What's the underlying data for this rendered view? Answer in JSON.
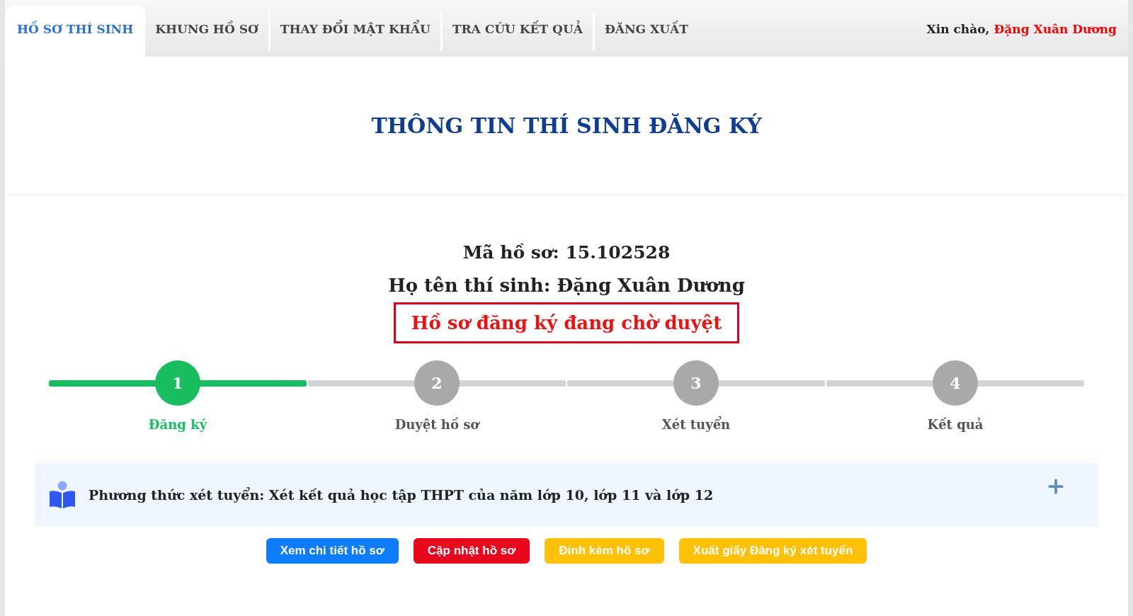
{
  "nav": {
    "tabs": [
      {
        "label": "HỒ SƠ THÍ SINH",
        "selected": true
      },
      {
        "label": "KHUNG HỒ SƠ",
        "selected": false
      },
      {
        "label": "THAY ĐỔI MẬT KHẨU",
        "selected": false
      },
      {
        "label": "TRA CỨU KẾT QUẢ",
        "selected": false
      },
      {
        "label": "ĐĂNG XUẤT",
        "selected": false
      }
    ],
    "greeting": {
      "label": "Xin chào,",
      "name": "Đặng Xuân Dương"
    }
  },
  "page_title": "THÔNG TIN THÍ SINH ĐĂNG KÝ",
  "profile": {
    "code": "Mã hồ sơ: 15.102528",
    "name": "Họ tên thí sinh: Đặng Xuân Dương",
    "status": "Hồ sơ đăng ký đang chờ duyệt"
  },
  "steps": [
    {
      "number": "1",
      "label": "Đăng ký",
      "active": true
    },
    {
      "number": "2",
      "label": "Duyệt hồ sơ",
      "active": false
    },
    {
      "number": "3",
      "label": "Xét tuyển",
      "active": false
    },
    {
      "number": "4",
      "label": "Kết quả",
      "active": false
    }
  ],
  "admission_method": {
    "text": "Phương thức xét tuyển: Xét kết quả học tập THPT của năm lớp 10, lớp 11 và lớp 12",
    "expanded": false
  },
  "buttons": [
    {
      "label": "Xem chi tiết hồ sơ",
      "kind": "primary"
    },
    {
      "label": "Cập nhật hồ sơ",
      "kind": "danger"
    },
    {
      "label": "Đính kèm hồ sơ",
      "kind": "warning"
    },
    {
      "label": "Xuất giấy Đăng ký xét tuyển",
      "kind": "warning"
    }
  ]
}
